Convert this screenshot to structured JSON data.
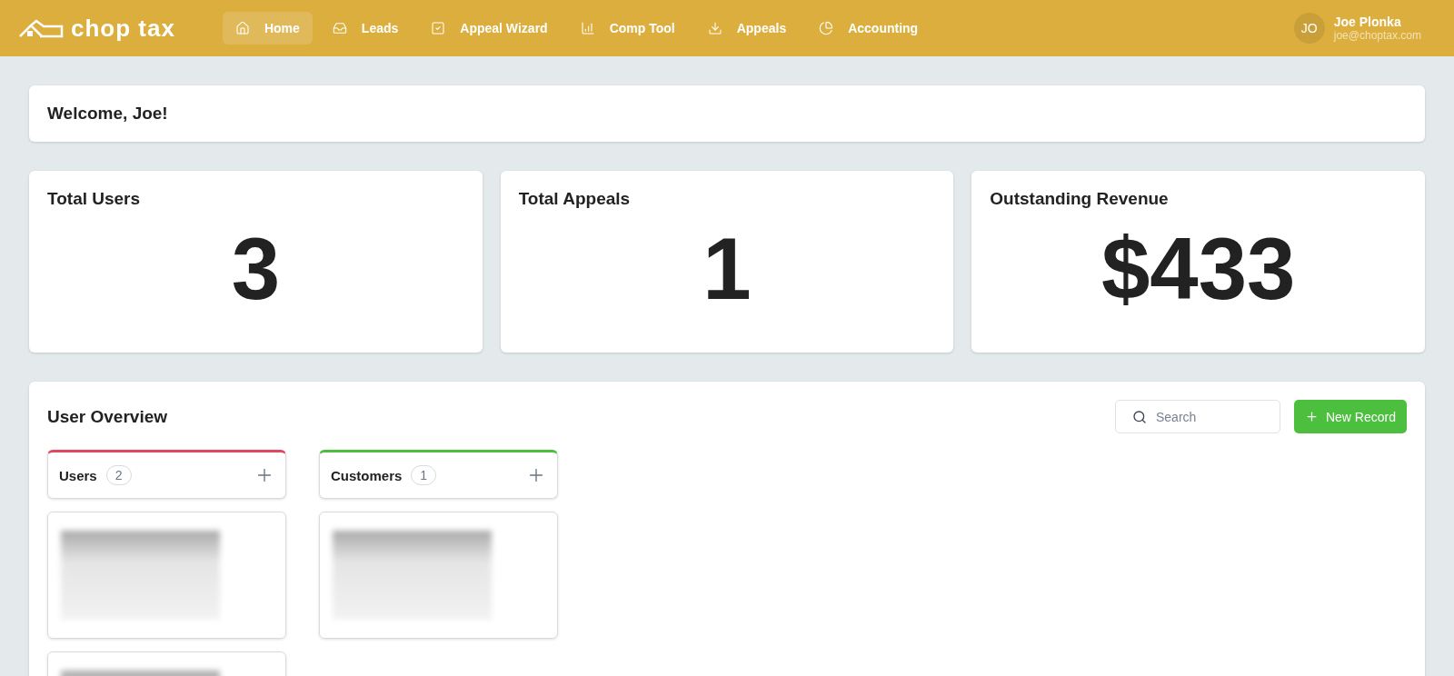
{
  "brand": "chop tax",
  "nav": [
    {
      "label": "Home",
      "selected": true
    },
    {
      "label": "Leads",
      "selected": false
    },
    {
      "label": "Appeal Wizard",
      "selected": false
    },
    {
      "label": "Comp Tool",
      "selected": false
    },
    {
      "label": "Appeals",
      "selected": false
    },
    {
      "label": "Accounting",
      "selected": false
    }
  ],
  "user": {
    "initials": "JO",
    "name": "Joe Plonka",
    "email": "joe@choptax.com"
  },
  "welcome": "Welcome, Joe!",
  "stats": [
    {
      "title": "Total Users",
      "value": "3"
    },
    {
      "title": "Total Appeals",
      "value": "1"
    },
    {
      "title": "Outstanding Revenue",
      "value": "$433"
    }
  ],
  "overview": {
    "title": "User Overview",
    "search": {
      "placeholder": "Search"
    },
    "new_button": "New Record",
    "columns": [
      {
        "name": "Users",
        "count": "2",
        "color": "#e0485f",
        "cards": [
          {
            "kind": "redacted"
          },
          {
            "kind": "redacted"
          }
        ]
      },
      {
        "name": "Customers",
        "count": "1",
        "color": "#4cbf3f",
        "cards": [
          {
            "kind": "redacted"
          }
        ]
      }
    ]
  }
}
